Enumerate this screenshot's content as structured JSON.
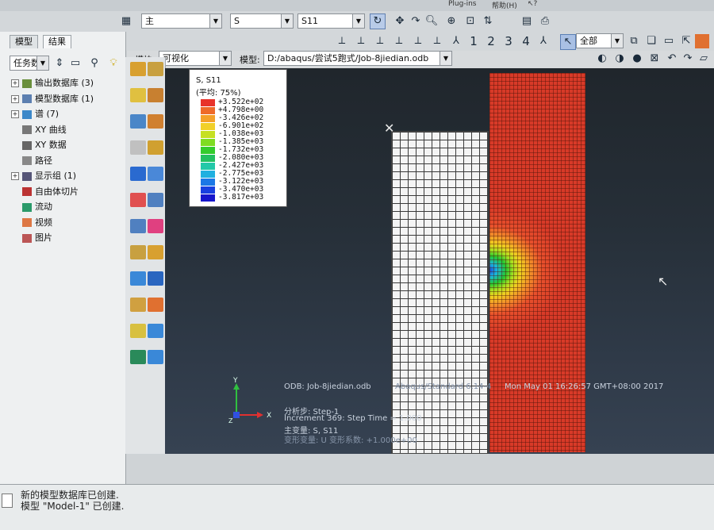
{
  "top_menu": {
    "plugins": "Plug-ins",
    "help": "帮助(H)"
  },
  "toolbar1": {
    "combo1": "主",
    "combo2": "S",
    "combo3": "S11"
  },
  "toolbar2": {
    "views": [
      "1",
      "2",
      "3",
      "4"
    ],
    "right_combo": "全部"
  },
  "left_tabs": {
    "model": "模型",
    "results": "结果"
  },
  "left_toolbar": {
    "tasks_combo": "任务数"
  },
  "module_bar": {
    "module_label": "模块:",
    "module_value": "可视化",
    "model_label": "模型:",
    "model_value": "D:/abaqus/尝试5跑式/Job-8jiedian.odb"
  },
  "tree": [
    {
      "label": "输出数据库 (3)",
      "expander": "+",
      "icon": "database-icon"
    },
    {
      "label": "模型数据库 (1)",
      "expander": "+",
      "icon": "model-db-icon"
    },
    {
      "label": "谱 (7)",
      "expander": "+",
      "icon": "spectrum-icon"
    },
    {
      "label": "XY 曲线",
      "expander": "",
      "icon": "xy-curve-icon"
    },
    {
      "label": "XY 数据",
      "expander": "",
      "icon": "xy-data-icon"
    },
    {
      "label": "路径",
      "expander": "",
      "icon": "path-icon"
    },
    {
      "label": "显示组 (1)",
      "expander": "+",
      "icon": "display-group-icon"
    },
    {
      "label": "自由体切片",
      "expander": "",
      "icon": "free-body-icon"
    },
    {
      "label": "流动",
      "expander": "",
      "icon": "stream-icon"
    },
    {
      "label": "视频",
      "expander": "",
      "icon": "movie-icon"
    },
    {
      "label": "图片",
      "expander": "",
      "icon": "image-icon"
    }
  ],
  "legend": {
    "title1": "S, S11",
    "title2": "(平均: 75%)",
    "values": [
      "+3.522e+02",
      "+4.798e+00",
      "-3.426e+02",
      "-6.901e+02",
      "-1.038e+03",
      "-1.385e+03",
      "-1.732e+03",
      "-2.080e+03",
      "-2.427e+03",
      "-2.775e+03",
      "-3.122e+03",
      "-3.470e+03",
      "-3.817e+03"
    ],
    "colors": [
      "#e8332a",
      "#ee6a2a",
      "#f4a02a",
      "#f1d02a",
      "#c6e022",
      "#7fdc22",
      "#33cc2c",
      "#22c060",
      "#22c8a8",
      "#20b0e0",
      "#1b78e6",
      "#1840e0",
      "#1616cc"
    ]
  },
  "viewport_info": {
    "odb_line": "ODB: Job-8jiedian.odb",
    "solver_line": "Abaqus/Standard 6.14-4",
    "date_line": "Mon May 01 16:26:57 GMT+08:00 2017",
    "step_line": "分析步: Step-1",
    "increment_line": "Increment    369: Step Time = 1.000",
    "primary_line": "主变量: S, S11",
    "deformed_line": "变形变量: U  变形系数: +1.000e+00"
  },
  "triad": {
    "x": "X",
    "y": "Y",
    "z": "Z"
  },
  "messages": [
    "新的模型数据库已创建.",
    "模型 \"Model-1\" 已创建."
  ],
  "colors": {
    "accent_blue": "#2a5aa8",
    "viewport_bg": "#262f38"
  }
}
